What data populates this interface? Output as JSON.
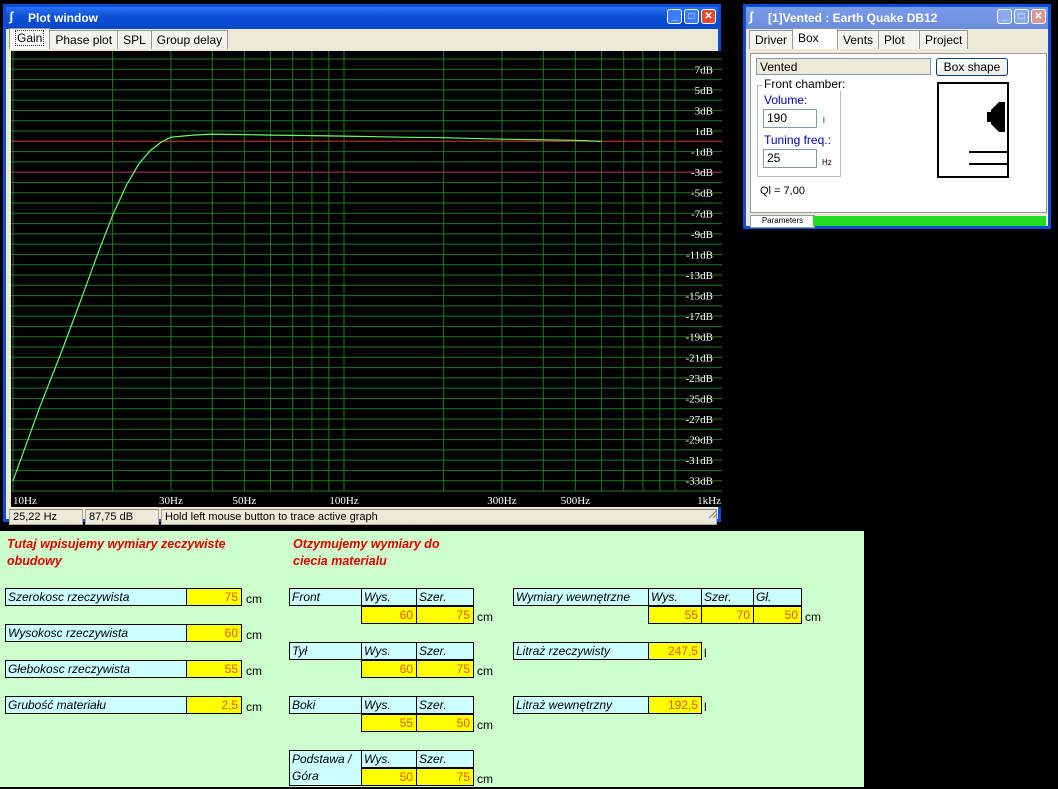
{
  "plot_window": {
    "title": "Plot window",
    "tabs": [
      "Gain",
      "Phase plot",
      "SPL",
      "Group delay"
    ],
    "status": {
      "freq": "25,22 Hz",
      "level": "87,75 dB",
      "hint": "Hold left mouse button to trace active graph"
    }
  },
  "chart_data": {
    "type": "line",
    "x_scale": "log",
    "xlim": [
      10,
      1000
    ],
    "ylim": [
      -34,
      8
    ],
    "x_ticks": [
      {
        "v": 10,
        "label": "10Hz"
      },
      {
        "v": 30,
        "label": "30Hz"
      },
      {
        "v": 50,
        "label": "50Hz"
      },
      {
        "v": 100,
        "label": "100Hz"
      },
      {
        "v": 300,
        "label": "300Hz"
      },
      {
        "v": 500,
        "label": "500Hz"
      },
      {
        "v": 1000,
        "label": "1kHz"
      }
    ],
    "y_ticks": [
      "7dB",
      "5dB",
      "3dB",
      "1dB",
      "-1dB",
      "-3dB",
      "-5dB",
      "-7dB",
      "-9dB",
      "-11dB",
      "-13dB",
      "-15dB",
      "-17dB",
      "-19dB",
      "-21dB",
      "-23dB",
      "-25dB",
      "-27dB",
      "-29dB",
      "-31dB",
      "-33dB"
    ],
    "y_tick_values": [
      7,
      5,
      3,
      1,
      -1,
      -3,
      -5,
      -7,
      -9,
      -11,
      -13,
      -15,
      -17,
      -19,
      -21,
      -23,
      -25,
      -27,
      -29,
      -31,
      -33
    ],
    "reference_lines": [
      {
        "y": 0,
        "color": "#cc2222"
      },
      {
        "y": -3,
        "color": "#aa2266"
      }
    ],
    "grid": true,
    "series": [
      {
        "color": "#66ff66",
        "x": [
          10,
          12,
          14,
          16,
          18,
          20,
          22,
          24,
          26,
          28,
          30,
          35,
          40,
          50,
          60,
          80,
          100,
          150,
          200,
          300,
          500,
          600
        ],
        "y": [
          -33,
          -26,
          -20.5,
          -15.5,
          -11,
          -7.2,
          -4.3,
          -2.2,
          -0.9,
          -0.1,
          0.4,
          0.6,
          0.7,
          0.65,
          0.6,
          0.55,
          0.5,
          0.4,
          0.35,
          0.2,
          0.1,
          0
        ]
      }
    ]
  },
  "box_window": {
    "title": "[1]Vented : Earth Quake DB12",
    "tabs": [
      "Driver",
      "Box",
      "Vents",
      "Plot",
      "Project"
    ],
    "box_type": "Vented",
    "box_shape_button": "Box shape",
    "front_chamber_label": "Front chamber:",
    "volume_label": "Volume:",
    "volume_value": "190",
    "volume_unit": "l",
    "tuning_label": "Tuning freq.:",
    "tuning_value": "25",
    "tuning_unit": "Hz",
    "ql": "Ql = 7,00",
    "param_tab": "Parameters",
    "progress": 1.0
  },
  "sheet": {
    "heading_left": [
      "Tutaj wpisujemy wymiary zeczywiste",
      "obudowy"
    ],
    "heading_right": [
      "Otzymujemy wymiary do",
      "ciecia materialu"
    ],
    "inputs": [
      {
        "label": "Szerokosc rzeczywista",
        "value": "75",
        "unit": "cm"
      },
      {
        "label": "Wysokosc rzeczywista",
        "value": "60",
        "unit": "cm"
      },
      {
        "label": "Głebokosc rzeczywista",
        "value": "55",
        "unit": "cm"
      },
      {
        "label": "Grubość materiału",
        "value": "2,5",
        "unit": "cm"
      }
    ],
    "wys": "Wys.",
    "szer": "Szer.",
    "gl": "Gł.",
    "cm": "cm",
    "liter": "l",
    "parts": [
      {
        "label": "Front",
        "wys": "60",
        "szer": "75"
      },
      {
        "label": "Tył",
        "wys": "60",
        "szer": "75"
      },
      {
        "label": "Boki",
        "wys": "55",
        "szer": "50"
      },
      {
        "label1": "Podstawa /",
        "label2": "Góra",
        "wys": "50",
        "szer": "75"
      }
    ],
    "internal": {
      "label": "Wymiary wewnętrzne",
      "wys": "55",
      "szer": "70",
      "gl": "50"
    },
    "litraz_real": {
      "label": "Litraż rzeczywisty",
      "value": "247,5"
    },
    "litraz_internal": {
      "label": "Litraż wewnętrzny",
      "value": "192,5"
    }
  }
}
